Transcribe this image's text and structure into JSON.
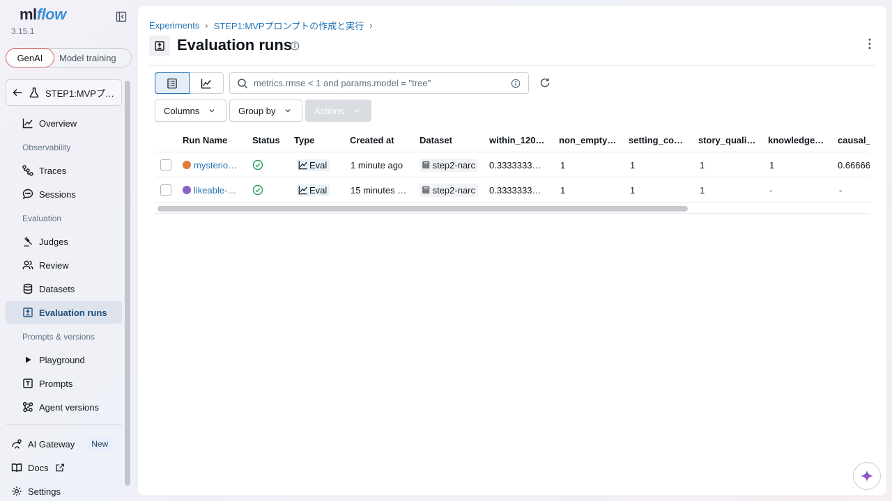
{
  "app": {
    "logo_ml": "ml",
    "logo_flow": "flow",
    "version": "3.15.1"
  },
  "sidebar": {
    "mode_genai": "GenAI",
    "mode_training": "Model training",
    "experiment_label": "STEP1:MVPプ…",
    "items": {
      "overview": "Overview",
      "section_observability": "Observability",
      "traces": "Traces",
      "sessions": "Sessions",
      "section_evaluation": "Evaluation",
      "judges": "Judges",
      "review": "Review",
      "datasets": "Datasets",
      "evaluation_runs": "Evaluation runs",
      "section_prompts": "Prompts & versions",
      "playground": "Playground",
      "prompts": "Prompts",
      "agent_versions": "Agent versions"
    },
    "bottom": {
      "ai_gateway": "AI Gateway",
      "new_badge": "New",
      "docs": "Docs",
      "settings": "Settings"
    }
  },
  "header": {
    "breadcrumb": [
      "Experiments",
      "STEP1:MVPプロンプトの作成と実行"
    ],
    "title": "Evaluation runs"
  },
  "toolbar": {
    "search_placeholder": "metrics.rmse < 1 and params.model = \"tree\"",
    "columns_label": "Columns",
    "group_by_label": "Group by",
    "actions_label": "Actions"
  },
  "table": {
    "headers": {
      "run_name": "Run Name",
      "status": "Status",
      "type": "Type",
      "created_at": "Created at",
      "dataset": "Dataset",
      "within": "within_120…",
      "non_empty": "non_empty…",
      "setting": "setting_co…",
      "story": "story_quali…",
      "knowledge": "knowledge…",
      "causal": "causal_"
    },
    "rows": [
      {
        "run_name": "mysterio…",
        "dot_color": "#e07b39",
        "type": "Eval",
        "created_at": "1 minute ago",
        "dataset": "step2-narc",
        "within": "0.3333333…",
        "non_empty": "1",
        "setting": "1",
        "story": "1",
        "knowledge": "1",
        "causal": "0.66666"
      },
      {
        "run_name": "likeable-…",
        "dot_color": "#8a63c9",
        "type": "Eval",
        "created_at": "15 minutes …",
        "dataset": "step2-narc",
        "within": "0.3333333…",
        "non_empty": "1",
        "setting": "1",
        "story": "1",
        "knowledge": "-",
        "causal": "-"
      }
    ]
  },
  "colors": {
    "accent": "#2272b4",
    "status_ok": "#1f9e5a",
    "active_nav_bg": "#dde3ed"
  }
}
